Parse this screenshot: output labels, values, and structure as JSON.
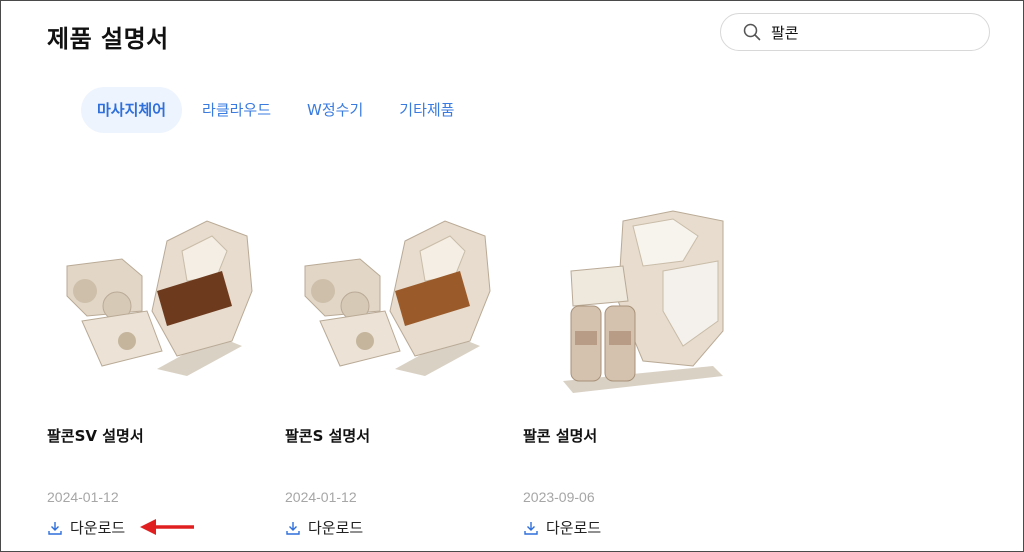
{
  "header": {
    "title": "제품 설명서"
  },
  "search": {
    "value": "팔콘",
    "icon": "search-icon"
  },
  "tabs": [
    {
      "label": "마사지체어",
      "active": true
    },
    {
      "label": "라클라우드",
      "active": false
    },
    {
      "label": "W정수기",
      "active": false
    },
    {
      "label": "기타제품",
      "active": false
    }
  ],
  "products": [
    {
      "name": "팔콘SV 설명서",
      "date": "2024-01-12",
      "download_label": "다운로드",
      "accent": "#6e3a1e"
    },
    {
      "name": "팔콘S 설명서",
      "date": "2024-01-12",
      "download_label": "다운로드",
      "accent": "#9a5a2a"
    },
    {
      "name": "팔콘 설명서",
      "date": "2023-09-06",
      "download_label": "다운로드",
      "accent": "#f4f1ec"
    }
  ],
  "colors": {
    "tab_text": "#3a7be0",
    "tab_active_bg": "#eef4fd",
    "download_icon": "#2f6fdb",
    "annotation_arrow": "#e02020",
    "chair_body": "#e7dccd",
    "chair_shadow": "#b9aa96"
  }
}
